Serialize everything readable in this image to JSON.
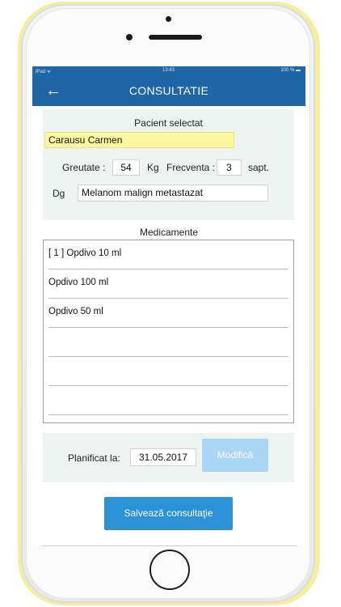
{
  "status_bar": {
    "left": "iPad ᯤ",
    "time": "13:43",
    "right": "100 % ▬"
  },
  "header": {
    "title": "CONSULTATIE"
  },
  "patient": {
    "section_label": "Pacient selectat",
    "name": "Carausu Carmen",
    "weight_label": "Greutate :",
    "weight_value": "54",
    "weight_unit": "Kg",
    "frequency_label": "Frecventa :",
    "frequency_value": "3",
    "frequency_unit": "sapt.",
    "diagnosis_label": "Dg",
    "diagnosis_value": "Melanom malign metastazat"
  },
  "medications": {
    "section_label": "Medicamente",
    "items": [
      "[ 1 ] Opdivo 10 ml",
      "Opdivo 100 ml",
      "Opdivo 50 ml",
      "",
      "",
      ""
    ]
  },
  "planning": {
    "label": "Planificat la:",
    "date": "31.05.2017",
    "update_button": "Modifică"
  },
  "footer": {
    "save_button": "Salvează consultaţie"
  }
}
